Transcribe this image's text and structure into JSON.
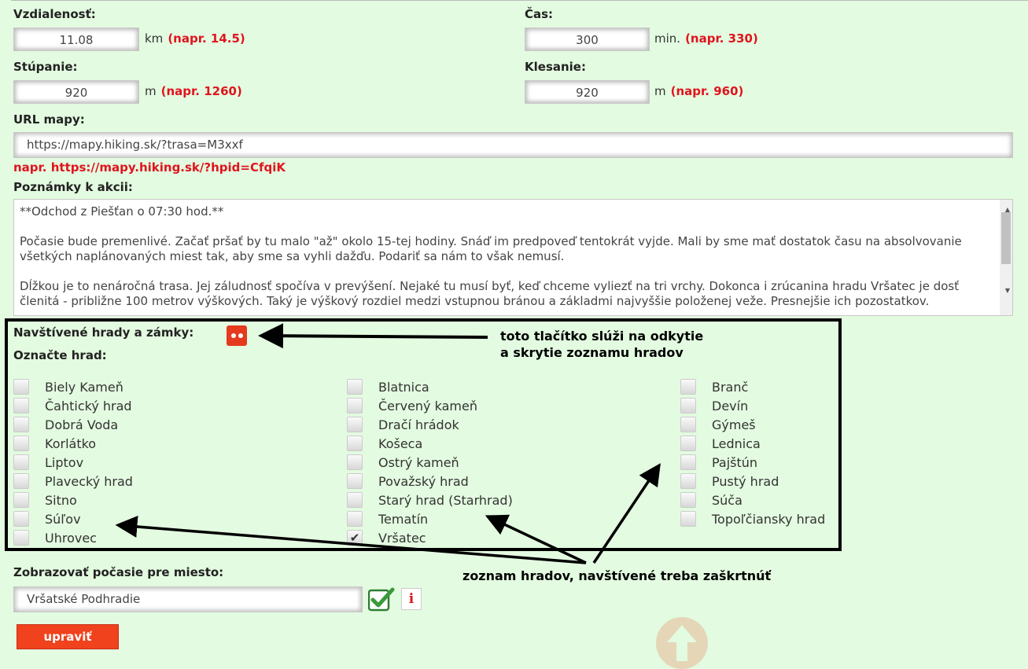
{
  "distance": {
    "label": "Vzdialenosť:",
    "value": "11.08",
    "unit": "km",
    "example": "(napr. 14.5)"
  },
  "time": {
    "label": "Čas:",
    "value": "300",
    "unit": "min.",
    "example": "(napr. 330)"
  },
  "ascent": {
    "label": "Stúpanie:",
    "value": "920",
    "unit": "m",
    "example": "(napr. 1260)"
  },
  "descent": {
    "label": "Klesanie:",
    "value": "920",
    "unit": "m",
    "example": "(napr. 960)"
  },
  "map_url": {
    "label": "URL mapy:",
    "value": "https://mapy.hiking.sk/?trasa=M3xxf",
    "example": "napr. https://mapy.hiking.sk/?hpid=CfqiK"
  },
  "notes": {
    "label": "Poznámky k akcii:",
    "paragraphs": [
      "**Odchod z Piešťan o 07:30 hod.**",
      "Počasie bude premenlivé. Začať pršať by tu malo \"až\" okolo 15-tej hodiny. Snáď im predpoveď tentokrát vyjde. Mali by sme mať dostatok času na absolvovanie všetkých naplánovaných miest tak, aby sme sa vyhli dažďu. Podariť sa nám to však nemusí.",
      "Dĺžkou je to nenáročná trasa. Jej záludnosť spočíva v prevýšení. Nejaké tu musí byť, keď chceme vyliezť na tri vrchy. Dokonca i zrúcanina hradu Vršatec je dosť členitá - približne 100 metrov výškových. Taký je výškový rozdiel medzi vstupnou bránou a základmi najvyššie položenej veže. Presnejšie ich pozostatkov."
    ]
  },
  "castles": {
    "title": "Navštívené hrady a zámky:",
    "subtitle": "Označte hrad:",
    "toggle_icon": "toggle-list-icon",
    "columns": [
      [
        {
          "name": "Biely Kameň",
          "checked": false
        },
        {
          "name": "Čahtický hrad",
          "checked": false
        },
        {
          "name": "Dobrá Voda",
          "checked": false
        },
        {
          "name": "Korlátko",
          "checked": false
        },
        {
          "name": "Liptov",
          "checked": false
        },
        {
          "name": "Plavecký hrad",
          "checked": false
        },
        {
          "name": "Sitno",
          "checked": false
        },
        {
          "name": "Súľov",
          "checked": false
        },
        {
          "name": "Uhrovec",
          "checked": false
        }
      ],
      [
        {
          "name": "Blatnica",
          "checked": false
        },
        {
          "name": "Červený kameň",
          "checked": false
        },
        {
          "name": "Dračí hrádok",
          "checked": false
        },
        {
          "name": "Košeca",
          "checked": false
        },
        {
          "name": "Ostrý kameň",
          "checked": false
        },
        {
          "name": "Považský hrad",
          "checked": false
        },
        {
          "name": "Starý hrad (Starhrad)",
          "checked": false
        },
        {
          "name": "Tematín",
          "checked": false
        },
        {
          "name": "Vršatec",
          "checked": true
        }
      ],
      [
        {
          "name": "Branč",
          "checked": false
        },
        {
          "name": "Devín",
          "checked": false
        },
        {
          "name": "Gýmeš",
          "checked": false
        },
        {
          "name": "Lednica",
          "checked": false
        },
        {
          "name": "Pajštún",
          "checked": false
        },
        {
          "name": "Pustý hrad",
          "checked": false
        },
        {
          "name": "Súča",
          "checked": false
        },
        {
          "name": "Topoľčiansky hrad",
          "checked": false
        }
      ]
    ]
  },
  "annotations": {
    "toggle_note_line1": "toto tlačítko slúži na odkytie",
    "toggle_note_line2": "a skrytie zoznamu hradov",
    "list_note": "zoznam hradov, navštívené treba zaškrtnúť"
  },
  "weather": {
    "label": "Zobrazovať počasie pre miesto:",
    "value": "Vršatské Podhradie",
    "confirm_icon": "checkmark-icon",
    "info_icon": "info-icon"
  },
  "submit_label": "upraviť",
  "scroll_top_icon": "arrow-up-icon"
}
